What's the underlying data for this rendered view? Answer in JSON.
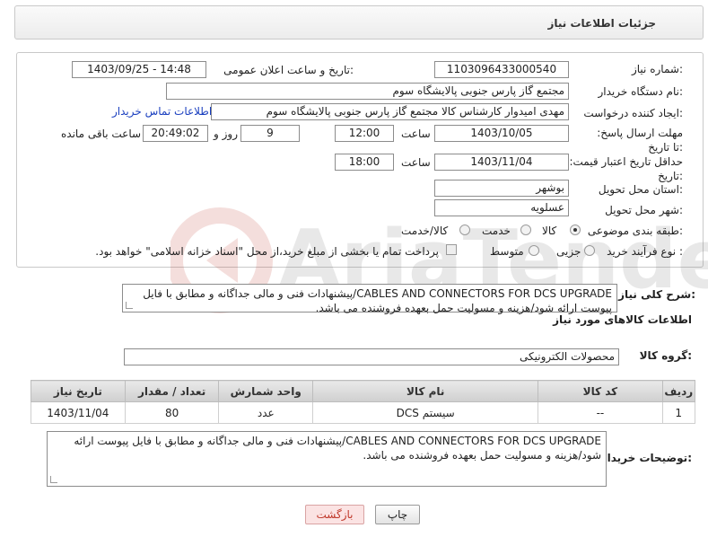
{
  "header": {
    "title": "جزئیات اطلاعات نیاز"
  },
  "form": {
    "need_number_label": "شماره نیاز:",
    "need_number": "1103096433000540",
    "announce_label": "تاریخ و ساعت اعلان عمومی:",
    "announce_value": "1403/09/25 - 14:48",
    "buyer_org_label": "نام دستگاه خریدار:",
    "buyer_org": "مجتمع گاز پارس جنوبی  پالایشگاه سوم",
    "creator_label": "ایجاد کننده درخواست:",
    "creator": "مهدی امیدوار کارشناس کالا مجتمع گاز پارس جنوبی  پالایشگاه سوم",
    "buyer_contact_link": "اطلاعات تماس خریدار",
    "reply_deadline_label": "مهلت ارسال پاسخ: تا تاریخ:",
    "reply_date": "1403/10/05",
    "time_label": "ساعت",
    "reply_time": "12:00",
    "days_count": "9",
    "days_label": "روز و",
    "remaining_time": "20:49:02",
    "remaining_label": "ساعت باقی مانده",
    "validity_label": "حداقل تاریخ اعتبار قیمت: تا تاریخ:",
    "validity_date": "1403/11/04",
    "validity_time": "18:00",
    "province_label": "استان محل تحویل:",
    "province": "بوشهر",
    "city_label": "شهر محل تحویل:",
    "city": "عسلویه",
    "category_label": "طبقه بندی موضوعی:",
    "category_options": [
      "کالا",
      "خدمت",
      "کالا/خدمت"
    ],
    "category_selected": "کالا",
    "process_label": "نوع فرآیند خرید :",
    "process_options": [
      "جزیی",
      "متوسط"
    ],
    "payment_note": "پرداخت تمام یا بخشی از مبلغ خرید،از محل \"اسناد خزانه اسلامی\" خواهد بود."
  },
  "summary": {
    "label": "شرح کلی نیاز:",
    "text": "CABLES AND CONNECTORS FOR DCS UPGRADE/پیشنهادات فنی و مالی جداگانه و مطابق با فایل پیوست ارائه شود/هزینه و مسولیت حمل بعهده فروشنده می باشد."
  },
  "goods_section": {
    "title": "اطلاعات کالاهای مورد نیاز",
    "group_label": "گروه کالا:",
    "group_value": "محصولات الکترونیکی",
    "columns": [
      "ردیف",
      "کد کالا",
      "نام کالا",
      "واحد شمارش",
      "تعداد / مقدار",
      "تاریخ نیاز"
    ],
    "rows": [
      {
        "row": "1",
        "code": "--",
        "name": "سیستم DCS",
        "unit": "عدد",
        "qty": "80",
        "date": "1403/11/04"
      }
    ]
  },
  "buyer_notes": {
    "label": "توضیحات خریدار:",
    "text": "CABLES AND CONNECTORS FOR DCS UPGRADE/پیشنهادات فنی و مالی جداگانه و مطابق با فایل پیوست ارائه شود/هزینه و مسولیت حمل بعهده فروشنده می باشد."
  },
  "buttons": {
    "print": "چاپ",
    "back": "بازگشت"
  },
  "colors": {
    "link": "#1a3fbf",
    "back_button_bg": "#fbe3e3",
    "back_button_text": "#c0392b"
  }
}
